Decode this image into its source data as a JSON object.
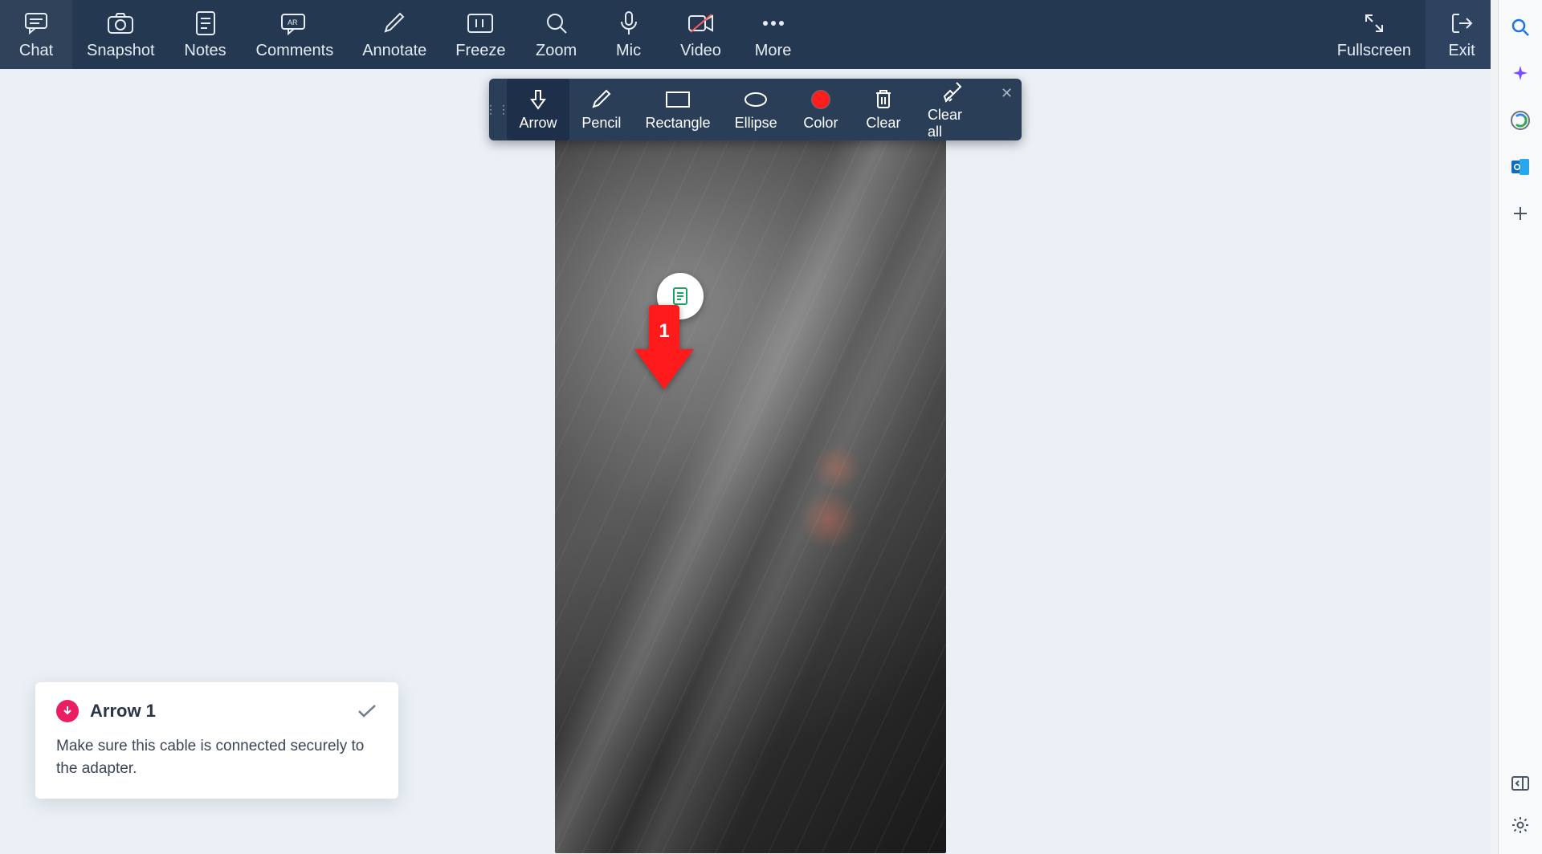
{
  "toolbar": {
    "items": [
      {
        "id": "chat",
        "label": "Chat"
      },
      {
        "id": "snapshot",
        "label": "Snapshot"
      },
      {
        "id": "notes",
        "label": "Notes"
      },
      {
        "id": "comments",
        "label": "Comments"
      },
      {
        "id": "annotate",
        "label": "Annotate"
      },
      {
        "id": "freeze",
        "label": "Freeze"
      },
      {
        "id": "zoom",
        "label": "Zoom"
      },
      {
        "id": "mic",
        "label": "Mic"
      },
      {
        "id": "video",
        "label": "Video"
      },
      {
        "id": "more",
        "label": "More"
      }
    ],
    "right": [
      {
        "id": "fullscreen",
        "label": "Fullscreen"
      },
      {
        "id": "exit",
        "label": "Exit"
      }
    ]
  },
  "annotate_bar": {
    "tools": [
      {
        "id": "arrow",
        "label": "Arrow",
        "selected": true
      },
      {
        "id": "pencil",
        "label": "Pencil",
        "selected": false
      },
      {
        "id": "rectangle",
        "label": "Rectangle",
        "selected": false
      },
      {
        "id": "ellipse",
        "label": "Ellipse",
        "selected": false
      },
      {
        "id": "color",
        "label": "Color",
        "selected": false,
        "value": "#ff1e1e"
      },
      {
        "id": "clear",
        "label": "Clear",
        "selected": false
      },
      {
        "id": "clearall",
        "label": "Clear all",
        "selected": false
      }
    ]
  },
  "annotation": {
    "marker_number": "1",
    "card_title": "Arrow 1",
    "card_body": "Make sure this cable is connected securely to the adapter."
  },
  "side_rail": {
    "top_icons": [
      "search",
      "copilot-sparkle",
      "copilot-loop",
      "outlook",
      "add"
    ],
    "bottom_icons": [
      "panel-toggle",
      "settings"
    ]
  },
  "colors": {
    "toolbar_bg": "#243852",
    "annotate_bg": "#2a3e58",
    "page_bg": "#eaf0f5",
    "annotation_red": "#ff1b1b",
    "card_pink": "#e91e63"
  }
}
